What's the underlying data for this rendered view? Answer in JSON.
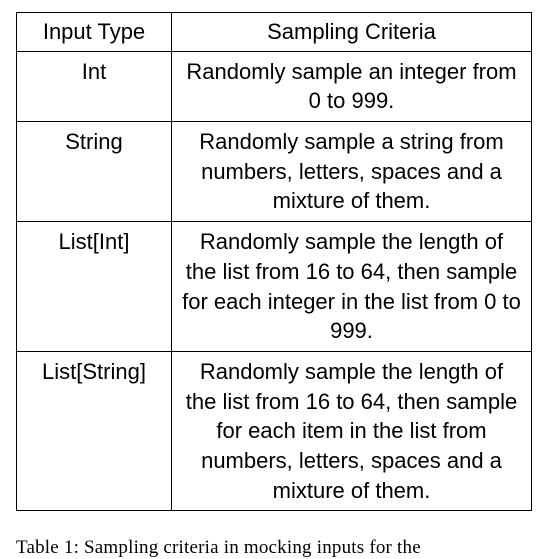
{
  "table": {
    "headers": [
      "Input Type",
      "Sampling Criteria"
    ],
    "rows": [
      {
        "type": "Int",
        "criteria": "Randomly sample an integer from 0 to 999."
      },
      {
        "type": "String",
        "criteria": "Randomly sample a string from numbers, letters, spaces and a mixture of them."
      },
      {
        "type": "List[Int]",
        "criteria": "Randomly sample the length of the list from 16 to 64, then sample for each integer in the list from 0 to 999."
      },
      {
        "type": "List[String]",
        "criteria": "Randomly sample the length of the list from 16 to 64, then sample for each item in the list from numbers, letters, spaces and a mixture of them."
      }
    ]
  },
  "caption_prefix": "Table 1:",
  "caption_rest": "Sampling criteria in mocking inputs for the"
}
